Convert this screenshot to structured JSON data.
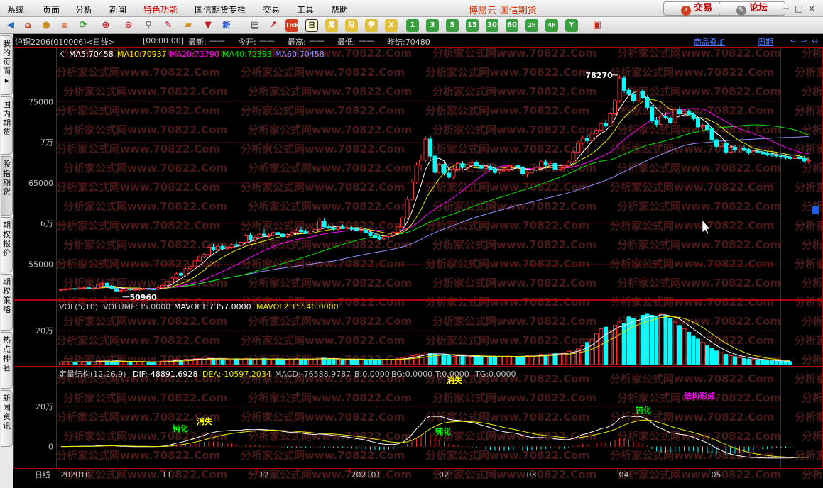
{
  "menu": {
    "items": [
      "系统",
      "页面",
      "分析",
      "新闻",
      "特色功能",
      "国信期货专栏",
      "交易",
      "工具",
      "帮助"
    ],
    "app_title": "博易云-国信期货",
    "trade_button": "交易",
    "forum_button": "论坛",
    "min_icon": "minimize-icon",
    "max_icon": "maximize-icon",
    "close_icon": "close-icon"
  },
  "toolbar": {
    "periods": [
      "1",
      "3",
      "5",
      "15",
      "30",
      "60",
      "2h",
      "4h"
    ],
    "ri": "日",
    "zhou": "周",
    "yue": "月",
    "ji": "季",
    "x": "X",
    "y": "Y",
    "tick": "Tick",
    "xin": "新"
  },
  "side_tabs": [
    "我的页面",
    "国内期货",
    "股指期货",
    "期权报价",
    "期权策略",
    "热点排名",
    "新闻资讯"
  ],
  "info": {
    "symbol": "沪铜2206(010006)<日线>",
    "time": "[00:00:00]",
    "latest_label": "最新:",
    "open_label": "今开:",
    "high_label": "最高:",
    "low_label": "最低:",
    "dash": "——",
    "prev_settle": "昨结:70480",
    "overlay_link": "商品叠加",
    "period_link": "周期"
  },
  "chart_data": {
    "type": "candlestick",
    "main_legend": {
      "k": "K",
      "ma5": "MA5:70458",
      "ma10": "MA10:70937",
      "ma20": "MA20:71790",
      "ma40": "MA40:72393",
      "ma60": "MA60:70458"
    },
    "price_axis": {
      "labels": [
        "75000",
        "7万",
        "65000",
        "6万",
        "55000"
      ],
      "values": [
        75000,
        70000,
        65000,
        60000,
        55000
      ],
      "ylim": [
        51200,
        80000
      ]
    },
    "high_marker": {
      "label": "78270",
      "value": 78270
    },
    "low_marker": {
      "label": "50960",
      "value": 50960
    },
    "vol_legend": {
      "vol": "VOL(5,10)",
      "volume": "VOLUME:35.0000",
      "mavol1": "MAVOL1:7357.0000",
      "mavol2": "MAVOL2:15546.0000"
    },
    "vol_axis": {
      "labels": [
        "20万"
      ],
      "values": [
        200000
      ],
      "ylim": [
        0,
        300000
      ]
    },
    "macd_legend": {
      "name": "定量结构(12,26,9)",
      "dif": "DIF:-48891.6928",
      "dea": "DEA:-10597.2034",
      "macd": "MACD:-76588.9787",
      "b": "B:0.0000",
      "bg": "BG:0.0000",
      "t": "T:0.0000",
      "tg": "TG:0.0000"
    },
    "macd_axis": {
      "labels": [
        "20万",
        "0"
      ],
      "values": [
        200000,
        0
      ],
      "ylim": [
        -100000,
        330000
      ]
    },
    "macd_annotations": {
      "dunhua": "钝化",
      "xiaoshi": "消失",
      "jiegou": "结构形成"
    },
    "time_axis": {
      "period_label": "日线",
      "labels": [
        "202010",
        "11",
        "12",
        "202101",
        "02",
        "03",
        "04",
        "05"
      ],
      "bar_index": [
        0,
        22,
        43,
        63,
        82,
        101,
        121,
        141
      ]
    },
    "bar_count": 158,
    "candles": [
      [
        51800,
        51950,
        51650,
        51900
      ],
      [
        51900,
        52050,
        51750,
        51950
      ],
      [
        51950,
        52100,
        51800,
        52000
      ],
      [
        52000,
        52150,
        51850,
        51950
      ],
      [
        51950,
        52200,
        51800,
        52050
      ],
      [
        52050,
        52300,
        51950,
        52100
      ],
      [
        52100,
        52200,
        51900,
        51950
      ],
      [
        51950,
        52150,
        51800,
        52050
      ],
      [
        52050,
        52700,
        51950,
        52500
      ],
      [
        52500,
        52900,
        52300,
        52650
      ],
      [
        52650,
        52800,
        52200,
        52300
      ],
      [
        52300,
        52450,
        51900,
        52000
      ],
      [
        52000,
        52100,
        51600,
        51700
      ],
      [
        51700,
        51900,
        51450,
        51800
      ],
      [
        51800,
        52000,
        51600,
        51950
      ],
      [
        51950,
        52100,
        51750,
        51850
      ],
      [
        51850,
        52000,
        51700,
        51900
      ],
      [
        51900,
        52050,
        51750,
        51950
      ],
      [
        51950,
        52100,
        51800,
        52000
      ],
      [
        52000,
        52100,
        51850,
        51950
      ],
      [
        51950,
        52050,
        51800,
        51900
      ],
      [
        51900,
        52150,
        51850,
        52100
      ],
      [
        52100,
        52500,
        52000,
        52400
      ],
      [
        52400,
        52950,
        52300,
        52850
      ],
      [
        52850,
        53500,
        52700,
        53300
      ],
      [
        53300,
        54000,
        53200,
        53850
      ],
      [
        53850,
        54100,
        53500,
        53650
      ],
      [
        53650,
        54600,
        53500,
        54450
      ],
      [
        54450,
        54900,
        54200,
        54700
      ],
      [
        54700,
        55600,
        54500,
        55400
      ],
      [
        55400,
        56100,
        55200,
        55900
      ],
      [
        55900,
        56400,
        55700,
        56200
      ],
      [
        56200,
        57300,
        56000,
        57100
      ],
      [
        57100,
        57500,
        56600,
        56800
      ],
      [
        56800,
        57400,
        56600,
        57200
      ],
      [
        57200,
        57500,
        56700,
        56900
      ],
      [
        56900,
        57300,
        56700,
        57100
      ],
      [
        57100,
        57600,
        56900,
        57400
      ],
      [
        57400,
        57800,
        57100,
        57300
      ],
      [
        57300,
        57900,
        57100,
        57700
      ],
      [
        57700,
        58800,
        57500,
        58500
      ],
      [
        58500,
        58900,
        57800,
        58000
      ],
      [
        58000,
        58500,
        57700,
        58300
      ],
      [
        58300,
        58900,
        58100,
        58700
      ],
      [
        58700,
        59300,
        58400,
        58500
      ],
      [
        58500,
        58800,
        58200,
        58600
      ],
      [
        58600,
        59100,
        58400,
        58900
      ],
      [
        58900,
        59300,
        58500,
        58700
      ],
      [
        58700,
        58900,
        58200,
        58400
      ],
      [
        58400,
        58800,
        58200,
        58600
      ],
      [
        58600,
        59100,
        58400,
        58900
      ],
      [
        58900,
        59400,
        58700,
        59200
      ],
      [
        59200,
        59600,
        58800,
        59000
      ],
      [
        59000,
        59300,
        58700,
        58800
      ],
      [
        58800,
        59200,
        58600,
        59100
      ],
      [
        59100,
        59500,
        58900,
        59300
      ],
      [
        59300,
        60700,
        59200,
        60300
      ],
      [
        60300,
        60600,
        59400,
        59600
      ],
      [
        59600,
        59900,
        59300,
        59500
      ],
      [
        59500,
        59800,
        59100,
        59300
      ],
      [
        59300,
        59700,
        59100,
        59600
      ],
      [
        59600,
        59900,
        59300,
        59400
      ],
      [
        59400,
        59800,
        59200,
        59500
      ],
      [
        59500,
        59700,
        59100,
        59300
      ],
      [
        59300,
        59600,
        59000,
        59100
      ],
      [
        59100,
        59400,
        58900,
        59200
      ],
      [
        59200,
        59500,
        58800,
        58900
      ],
      [
        58900,
        59100,
        58400,
        58500
      ],
      [
        58500,
        58800,
        58200,
        58300
      ],
      [
        58300,
        58600,
        57900,
        58100
      ],
      [
        58100,
        58500,
        57900,
        58400
      ],
      [
        58400,
        58700,
        58100,
        58600
      ],
      [
        58600,
        59100,
        58400,
        58900
      ],
      [
        58900,
        59800,
        58700,
        59600
      ],
      [
        59600,
        60900,
        59400,
        60700
      ],
      [
        60700,
        63300,
        60500,
        63000
      ],
      [
        63000,
        65400,
        62800,
        65100
      ],
      [
        65100,
        67500,
        64900,
        67200
      ],
      [
        67200,
        68500,
        66500,
        67800
      ],
      [
        67800,
        70700,
        67500,
        70400
      ],
      [
        70400,
        70800,
        67900,
        68300
      ],
      [
        68300,
        68600,
        66000,
        66300
      ],
      [
        66300,
        67500,
        66000,
        67300
      ],
      [
        67300,
        67800,
        65900,
        66200
      ],
      [
        66200,
        66600,
        65500,
        65700
      ],
      [
        65700,
        66900,
        65500,
        66700
      ],
      [
        66700,
        67600,
        66500,
        67400
      ],
      [
        67400,
        67700,
        66700,
        66900
      ],
      [
        66900,
        67400,
        66600,
        67200
      ],
      [
        67200,
        67800,
        66900,
        67500
      ],
      [
        67500,
        67800,
        66900,
        67100
      ],
      [
        67100,
        67400,
        66600,
        66800
      ],
      [
        66800,
        67200,
        66500,
        67000
      ],
      [
        67000,
        67300,
        66600,
        66700
      ],
      [
        66700,
        67000,
        66100,
        66300
      ],
      [
        66300,
        66700,
        66000,
        66500
      ],
      [
        66500,
        66900,
        66300,
        66700
      ],
      [
        66700,
        67200,
        66400,
        67000
      ],
      [
        67000,
        67400,
        66700,
        67200
      ],
      [
        67200,
        67500,
        66800,
        66900
      ],
      [
        66900,
        67100,
        65900,
        66100
      ],
      [
        66100,
        66500,
        65700,
        66300
      ],
      [
        66300,
        66800,
        66100,
        66600
      ],
      [
        66600,
        67100,
        66400,
        66900
      ],
      [
        66900,
        67800,
        66700,
        67600
      ],
      [
        67600,
        67900,
        67000,
        67200
      ],
      [
        67200,
        67700,
        66900,
        67400
      ],
      [
        67400,
        67800,
        66500,
        66700
      ],
      [
        66700,
        67100,
        66500,
        66900
      ],
      [
        66900,
        67300,
        66600,
        67100
      ],
      [
        67100,
        67800,
        66900,
        67600
      ],
      [
        67600,
        69000,
        67400,
        68800
      ],
      [
        68800,
        70200,
        68600,
        69900
      ],
      [
        69900,
        70800,
        69700,
        70500
      ],
      [
        70500,
        71000,
        69800,
        70200
      ],
      [
        70200,
        71300,
        70100,
        71100
      ],
      [
        71100,
        71700,
        70700,
        71500
      ],
      [
        71500,
        72500,
        71300,
        72300
      ],
      [
        72300,
        72800,
        71700,
        72000
      ],
      [
        72000,
        73700,
        71900,
        73500
      ],
      [
        73500,
        75300,
        73300,
        75100
      ],
      [
        75100,
        78270,
        74900,
        77900
      ],
      [
        77900,
        78200,
        76100,
        76400
      ],
      [
        76400,
        76700,
        75700,
        75900
      ],
      [
        75900,
        76300,
        74800,
        75100
      ],
      [
        75100,
        76500,
        74900,
        76300
      ],
      [
        76300,
        76600,
        75300,
        75500
      ],
      [
        75500,
        75800,
        74000,
        74300
      ],
      [
        74300,
        74600,
        72400,
        72700
      ],
      [
        72700,
        73100,
        71900,
        72200
      ],
      [
        72200,
        73400,
        72000,
        73200
      ],
      [
        73200,
        73700,
        72800,
        73000
      ],
      [
        73000,
        73300,
        72200,
        72400
      ],
      [
        72400,
        74300,
        72200,
        74000
      ],
      [
        74000,
        74400,
        73300,
        73500
      ],
      [
        73500,
        74000,
        73100,
        73800
      ],
      [
        73800,
        74100,
        73200,
        73400
      ],
      [
        73400,
        73700,
        72700,
        72900
      ],
      [
        72900,
        73100,
        71700,
        71900
      ],
      [
        71900,
        72300,
        71500,
        72100
      ],
      [
        72100,
        72400,
        71400,
        71600
      ],
      [
        71600,
        71900,
        70000,
        70300
      ],
      [
        70300,
        70600,
        69100,
        69500
      ],
      [
        69500,
        70100,
        69300,
        69900
      ],
      [
        69900,
        70200,
        68500,
        68800
      ],
      [
        68800,
        69600,
        68600,
        69400
      ],
      [
        69400,
        69700,
        68800,
        69100
      ],
      [
        69100,
        69500,
        68700,
        69300
      ],
      [
        69300,
        69600,
        68900,
        69000
      ],
      [
        69000,
        69300,
        68500,
        68700
      ],
      [
        68700,
        69100,
        68400,
        68900
      ],
      [
        68900,
        69200,
        68600,
        68800
      ],
      [
        68800,
        69000,
        68400,
        68600
      ],
      [
        68600,
        68900,
        68300,
        68500
      ],
      [
        68500,
        68800,
        68200,
        68400
      ],
      [
        68400,
        68700,
        68100,
        68300
      ],
      [
        68300,
        68600,
        68000,
        68200
      ],
      [
        68200,
        68500,
        67900,
        68100
      ],
      [
        68100,
        68400,
        67800,
        68000
      ],
      [
        68000,
        68300,
        67800,
        68200
      ],
      [
        68200,
        68500,
        67900,
        68000
      ],
      [
        68000,
        68300,
        67500,
        67700
      ],
      [
        67700,
        68000,
        67400,
        67800
      ]
    ],
    "volumes": [
      15000,
      16000,
      14000,
      15000,
      17000,
      18000,
      16000,
      15000,
      22000,
      26000,
      21000,
      19000,
      20000,
      17000,
      16000,
      15000,
      14000,
      15000,
      16000,
      15000,
      14000,
      16000,
      20000,
      24000,
      28000,
      30000,
      27000,
      31000,
      29000,
      34000,
      36000,
      33000,
      38000,
      35000,
      32000,
      34000,
      31000,
      33000,
      30000,
      32000,
      36000,
      34000,
      31000,
      33000,
      35000,
      30000,
      32000,
      34000,
      31000,
      30000,
      33000,
      35000,
      32000,
      30000,
      31000,
      33000,
      42000,
      38000,
      33000,
      31000,
      30000,
      29000,
      31000,
      30000,
      29000,
      28000,
      30000,
      32000,
      31000,
      30000,
      28000,
      29000,
      31000,
      34000,
      38000,
      45000,
      52000,
      60000,
      58000,
      70000,
      68000,
      62000,
      55000,
      58000,
      52000,
      48000,
      50000,
      53000,
      49000,
      47000,
      50000,
      48000,
      46000,
      49000,
      47000,
      45000,
      48000,
      50000,
      47000,
      46000,
      49000,
      52000,
      50000,
      54000,
      60000,
      58000,
      62000,
      64000,
      66000,
      70000,
      78000,
      85000,
      92000,
      110000,
      130000,
      150000,
      180000,
      210000,
      220000,
      200000,
      230000,
      250000,
      240000,
      280000,
      270000,
      260000,
      290000,
      300000,
      290000,
      280000,
      300000,
      290000,
      270000,
      250000,
      230000,
      210000,
      190000,
      170000,
      150000,
      130000,
      110000,
      95000,
      80000,
      70000,
      60000,
      52000,
      46000,
      40000,
      36000,
      32000,
      30000,
      28000,
      26000,
      24000,
      22000,
      20000,
      19000,
      18000,
      17000
    ]
  }
}
